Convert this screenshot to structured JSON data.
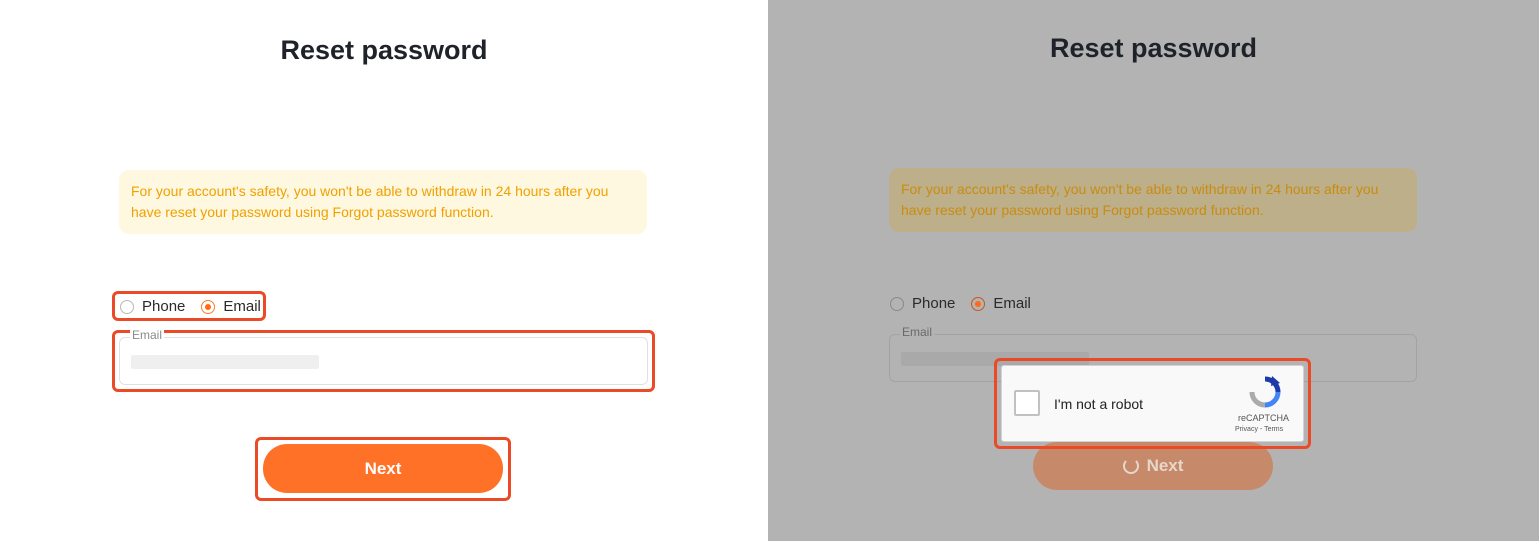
{
  "left": {
    "title": "Reset password",
    "notice": "For your account's safety, you won't be able to withdraw in 24 hours after you have reset your password using Forgot password function.",
    "radio_phone": "Phone",
    "radio_email": "Email",
    "email_label": "Email",
    "next_label": "Next"
  },
  "right": {
    "title": "Reset password",
    "notice": "For your account's safety, you won't be able to withdraw in 24 hours after you have reset your password using Forgot password function.",
    "radio_phone": "Phone",
    "radio_email": "Email",
    "email_label": "Email",
    "next_label": "Next",
    "captcha": {
      "label": "I'm not a robot",
      "brand": "reCAPTCHA",
      "privacy": "Privacy",
      "separator": " - ",
      "terms": "Terms"
    }
  },
  "colors": {
    "accent": "#ff7126",
    "highlight": "#ea4b26",
    "overlay": "#b3b3b3",
    "notice_bg": "#fff8e0"
  }
}
